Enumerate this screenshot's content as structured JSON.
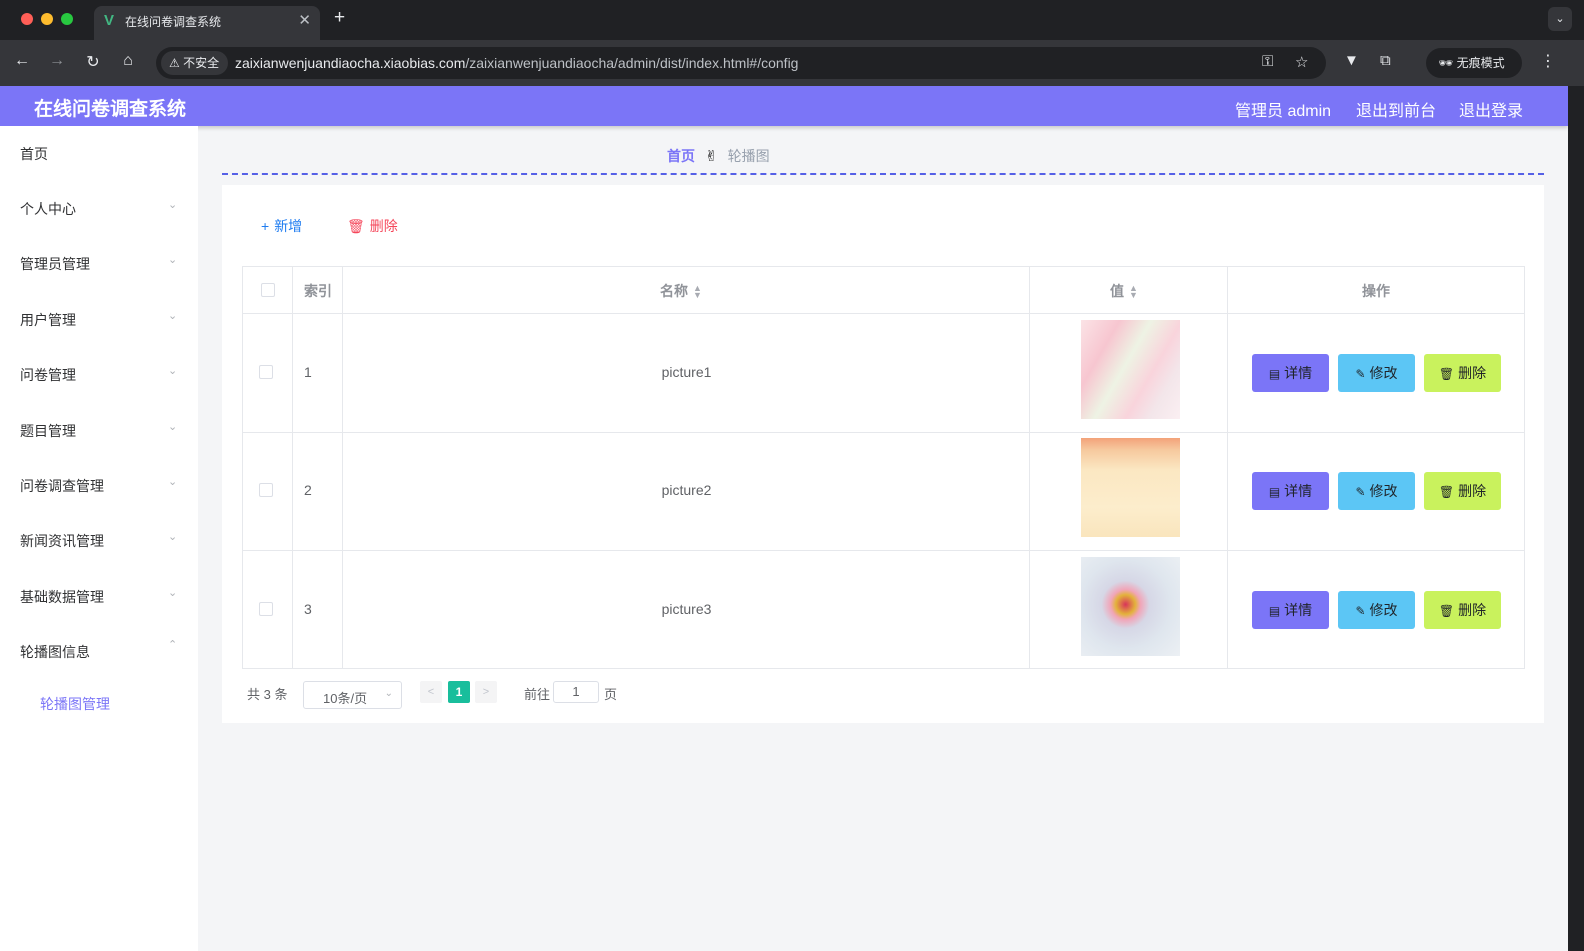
{
  "browser": {
    "tab_title": "在线问卷调查系统",
    "tab_favicon": "V",
    "tab_close": "✕",
    "new_tab": "+",
    "tab_menu": "⌄",
    "insecure_label": "不安全",
    "url_host": "zaixianwenjuandiaocha.xiaobias.com",
    "url_path": "/zaixianwenjuandiaocha/admin/dist/index.html#/config",
    "incognito_label": "无痕模式",
    "icons": [
      "back-icon",
      "forward-icon",
      "reload-icon",
      "home-icon",
      "key-icon",
      "star-icon",
      "extension-icon",
      "puzzle-icon",
      "incognito-icon",
      "menu-icon"
    ]
  },
  "header": {
    "title": "在线问卷调查系统",
    "user_label": "管理员 admin",
    "front_label": "退出到前台",
    "logout_label": "退出登录",
    "color": "#7b75f7"
  },
  "sidebar": {
    "items": [
      {
        "label": "首页",
        "has_arrow": false
      },
      {
        "label": "个人中心",
        "has_arrow": true
      },
      {
        "label": "管理员管理",
        "has_arrow": true
      },
      {
        "label": "用户管理",
        "has_arrow": true
      },
      {
        "label": "问卷管理",
        "has_arrow": true
      },
      {
        "label": "题目管理",
        "has_arrow": true
      },
      {
        "label": "问卷调查管理",
        "has_arrow": true
      },
      {
        "label": "新闻资讯管理",
        "has_arrow": true
      },
      {
        "label": "基础数据管理",
        "has_arrow": true
      },
      {
        "label": "轮播图信息",
        "has_arrow": true,
        "expanded": true
      }
    ],
    "submenu": {
      "label": "轮播图管理",
      "active": true
    }
  },
  "breadcrumb": {
    "home": "首页",
    "separator": "✌",
    "current": "轮播图"
  },
  "toolbar": {
    "add_label": "新增",
    "delete_label": "删除"
  },
  "table": {
    "headers": {
      "index": "索引",
      "name": "名称",
      "value": "值",
      "actions": "操作"
    },
    "rows": [
      {
        "index": "1",
        "name": "picture1",
        "image": "pink-blossom-image"
      },
      {
        "index": "2",
        "name": "picture2",
        "image": "cream-tulip-image"
      },
      {
        "index": "3",
        "name": "picture3",
        "image": "flower-bouquet-image"
      }
    ],
    "action_labels": {
      "detail": "详情",
      "edit": "修改",
      "remove": "删除"
    }
  },
  "pagination": {
    "total": "共 3 条",
    "page_size": "10条/页",
    "current_page": "1",
    "goto_label": "前往",
    "goto_value": "1",
    "page_suffix": "页"
  }
}
